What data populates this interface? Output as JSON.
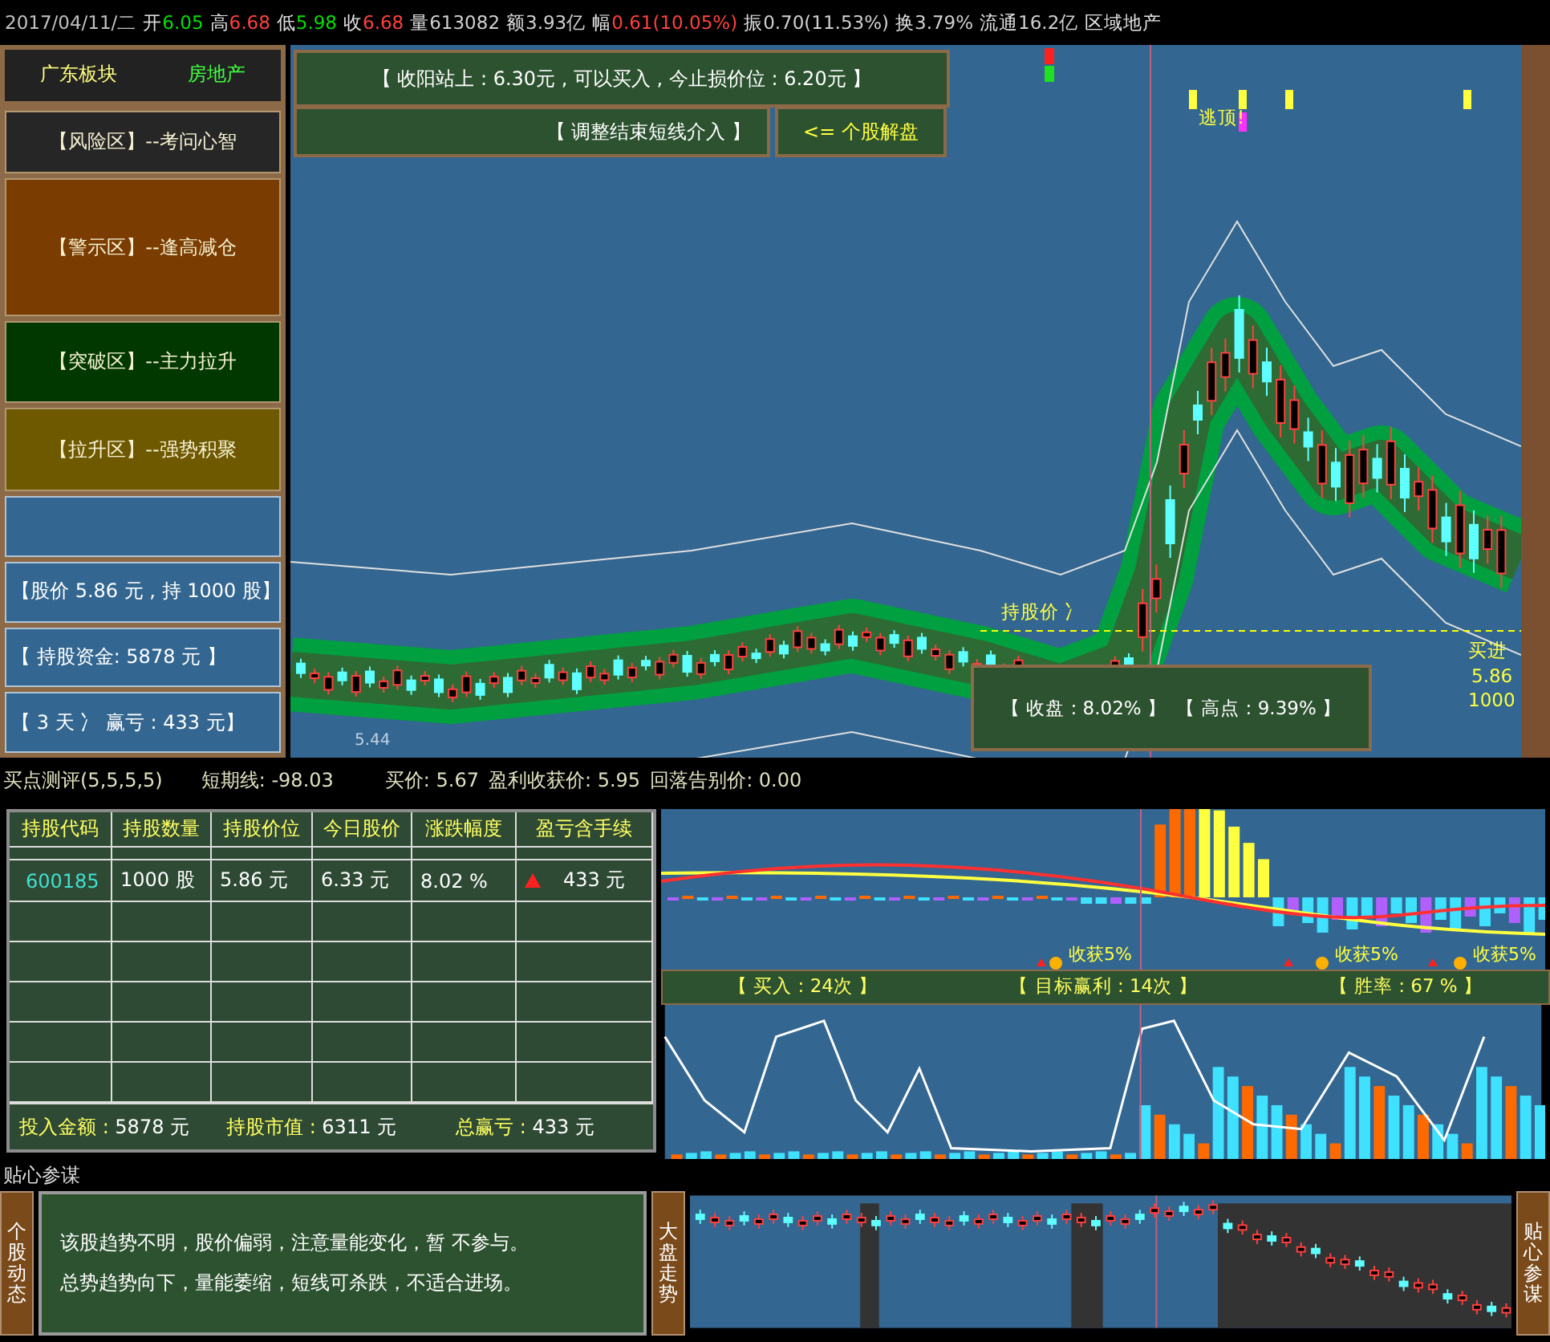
{
  "header": {
    "date": "2017/04/11/二",
    "fields": [
      {
        "label": "开",
        "value": "6.05",
        "color": "#00e000"
      },
      {
        "label": "高",
        "value": "6.68",
        "color": "#ff4040"
      },
      {
        "label": "低",
        "value": "5.98",
        "color": "#00e000"
      },
      {
        "label": "收",
        "value": "6.68",
        "color": "#ff4040"
      },
      {
        "label": "量",
        "value": "613082",
        "color": "#d0d0d0"
      },
      {
        "label": "额",
        "value": "3.93亿",
        "color": "#d0d0d0"
      },
      {
        "label": "幅",
        "value": "0.61(10.05%)",
        "color": "#ff4040"
      },
      {
        "label": "振",
        "value": "0.70(11.53%)",
        "color": "#d0d0d0"
      },
      {
        "label": "换",
        "value": "3.79%",
        "color": "#d0d0d0"
      },
      {
        "label": "流通",
        "value": "16.2亿",
        "color": "#d0d0d0"
      }
    ],
    "sector": "区域地产"
  },
  "left_panel": {
    "region": "广东板块",
    "industry": "房地产",
    "zones": [
      {
        "text": "【风险区】--考问心智",
        "kind": "risk"
      },
      {
        "text": "【警示区】--逢高减仓",
        "kind": "warning"
      },
      {
        "text": "【突破区】--主力拉升",
        "kind": "breakout"
      },
      {
        "text": "【拉升区】--强势积聚",
        "kind": "rally"
      }
    ],
    "holding": [
      "【股价 5.86 元 , 持 1000 股】",
      "【 持股资金:  5878 元 】",
      "【 3 天 冫 赢亏 : 433 元】"
    ]
  },
  "chart": {
    "signal": "【 收阳站上 : 6.30元 , 可以买入 , 今止损价位 : 6.20元 】",
    "adjust": "【 调整结束短线介入 】",
    "analysis_link": "<= 个股解盘",
    "escape_label": "逃顶!",
    "hold_price_label": "持股价 冫",
    "buy_label": "买进",
    "buy_price": "5.86",
    "buy_qty": "1000",
    "low_label": "5.44",
    "close_stats": [
      "【 收盘 : 8.02% 】",
      "【 高点 : 9.39% 】"
    ]
  },
  "midbar": [
    "买点测评(5,5,5,5)",
    "短期线: -98.03",
    "买价: 5.67",
    "盈利收获价: 5.95",
    "回落告别价: 0.00"
  ],
  "table": {
    "columns": [
      "持股代码",
      "持股数量",
      "持股价位",
      "今日股价",
      "涨跌幅度",
      "盈亏含手续"
    ],
    "rows": [
      {
        "cells": [
          "600185",
          "1000 股",
          "5.86 元",
          "6.33 元",
          "8.02 %",
          "433 元"
        ],
        "profit_up": true
      }
    ],
    "footer": [
      {
        "label": "投入金额 : ",
        "value": "5878 元"
      },
      {
        "label": "持股市值 : ",
        "value": "6311 元"
      },
      {
        "label": "总赢亏 :",
        "value": "433 元"
      }
    ]
  },
  "indicator": {
    "take_profit_labels": [
      "收获5%",
      "收获5%",
      "收获5%"
    ],
    "stats": [
      "【 买入 : 24次 】",
      "【 目标赢利 : 14次 】",
      "【 胜率 : 67 % 】"
    ]
  },
  "advisor": {
    "title": "贴心参谋",
    "stock_label": "个股动态",
    "advice": [
      "该股趋势不明，股价偏弱，注意量能变化，暂 不参与。",
      "总势趋势向下，量能萎缩，短线可杀跌，不适合进场。"
    ],
    "market_label": "大盘走势",
    "side_label": "贴心参谋"
  }
}
